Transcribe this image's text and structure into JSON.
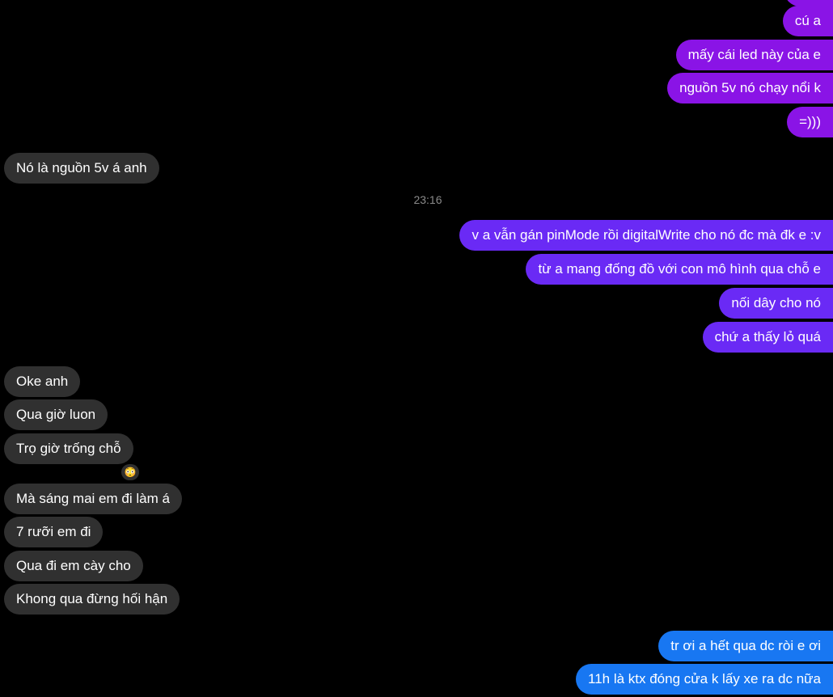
{
  "conversation": {
    "group1": [
      {
        "text": "cú a",
        "color": "#8a14e6"
      },
      {
        "text": "mấy cái led này của e",
        "color": "#8a14e6"
      },
      {
        "text": "nguồn 5v nó chạy nổi k",
        "color": "#8a14e6"
      },
      {
        "text": "=)))",
        "color": "#8a14e6"
      }
    ],
    "reply1": [
      {
        "text": "Nó là nguồn 5v á anh"
      }
    ],
    "timestamp": "23:16",
    "group2": [
      {
        "text": "v a vẫn gán pinMode rồi digitalWrite cho nó đc mà đk e :v",
        "color": "#6a2af5"
      },
      {
        "text": "từ a mang đống đồ với con mô hình qua chỗ e",
        "color": "#6a2af5"
      },
      {
        "text": "nối dây cho nó",
        "color": "#6a2af5"
      },
      {
        "text": "chứ a thấy lỏ quá",
        "color": "#6a2af5"
      }
    ],
    "reply2": [
      {
        "text": "Oke anh"
      },
      {
        "text": "Qua giờ luon"
      },
      {
        "text": "Trọ giờ trống chỗ"
      },
      {
        "text": "Mà sáng mai em đi làm á"
      },
      {
        "text": "7 rưỡi em đi"
      },
      {
        "text": "Qua đi em cày cho"
      },
      {
        "text": "Khong qua đừng hối hận"
      }
    ],
    "reaction": {
      "icon": "flushed-face-icon",
      "glyph": "😳"
    },
    "group3": [
      {
        "text": "tr ơi a hết qua dc ròi e ơi",
        "color": "#1877f2"
      },
      {
        "text": "11h là ktx đóng cửa k lấy xe ra dc nữa",
        "color": "#1877f2"
      }
    ]
  }
}
